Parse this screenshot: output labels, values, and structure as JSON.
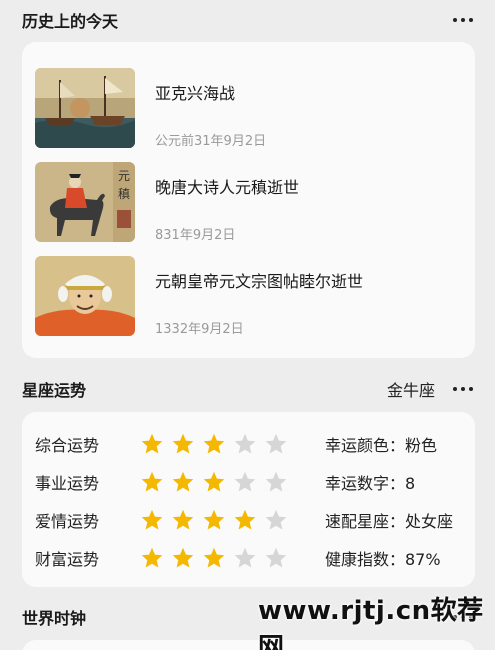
{
  "history": {
    "title": "历史上的今天",
    "events": [
      {
        "title": "亚克兴海战",
        "date": "公元前31年9月2日"
      },
      {
        "title": "晚唐大诗人元稹逝世",
        "date": "831年9月2日"
      },
      {
        "title": "元朝皇帝元文宗图帖睦尔逝世",
        "date": "1332年9月2日"
      }
    ]
  },
  "horoscope": {
    "title": "星座运势",
    "sign": "金牛座",
    "ratings": [
      {
        "label": "综合运势",
        "stars": 3,
        "info": "幸运颜色：粉色"
      },
      {
        "label": "事业运势",
        "stars": 3,
        "info": "幸运数字：8"
      },
      {
        "label": "爱情运势",
        "stars": 4,
        "info": "速配星座：处女座"
      },
      {
        "label": "财富运势",
        "stars": 3,
        "info": "健康指数：87%"
      }
    ],
    "max_stars": 5,
    "star_color": "#f5b800",
    "star_empty_color": "#d6d6d6"
  },
  "world_clock": {
    "title": "世界时钟"
  },
  "watermark": "www.rjtj.cn软荐网"
}
